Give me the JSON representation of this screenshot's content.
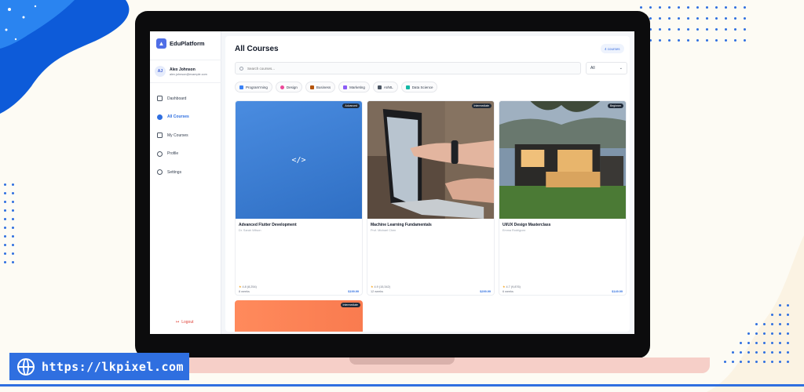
{
  "app": {
    "brand_name": "EduPlatform",
    "brand_icon": "graduation-cap-icon"
  },
  "user": {
    "initials": "AJ",
    "name": "Alex Johnson",
    "email": "alex.johnson@example.com"
  },
  "sidebar": {
    "items": [
      {
        "label": "Dashboard",
        "icon": "grid-icon",
        "active": false
      },
      {
        "label": "All Courses",
        "icon": "compass-icon",
        "active": true
      },
      {
        "label": "My Courses",
        "icon": "book-icon",
        "active": false
      },
      {
        "label": "Profile",
        "icon": "user-icon",
        "active": false
      },
      {
        "label": "Settings",
        "icon": "gear-icon",
        "active": false
      }
    ],
    "logout_label": "Logout"
  },
  "main": {
    "title": "All Courses",
    "count_badge": "4 courses",
    "search": {
      "placeholder": "Search courses..."
    },
    "filter": {
      "selected": "All"
    },
    "categories": [
      {
        "label": "Program'ming",
        "color": "#3b82f6"
      },
      {
        "label": "Design",
        "color": "#ec4899"
      },
      {
        "label": "Business",
        "color": "#b45309"
      },
      {
        "label": "Marketing",
        "color": "#8b5cf6"
      },
      {
        "label": "AI/ML",
        "color": "#4b5563"
      },
      {
        "label": "Data Science",
        "color": "#14b8a6"
      }
    ],
    "courses": [
      {
        "title": "Advanced Flutter Development",
        "author": "Dr. Sarah Wilson",
        "level": "Advanced",
        "rating": "4.8",
        "reviews": "(8,254)",
        "duration": "8 weeks",
        "price": "$199.99"
      },
      {
        "title": "Machine Learning Fundamentals",
        "author": "Prof. Michael Chen",
        "level": "Intermediate",
        "rating": "4.9",
        "reviews": "(15,342)",
        "duration": "12 weeks",
        "price": "$299.99"
      },
      {
        "title": "UI/UX Design Masterclass",
        "author": "Emma Rodriguez",
        "level": "Beginner",
        "rating": "4.7",
        "reviews": "(9,876)",
        "duration": "6 weeks",
        "price": "$149.99"
      },
      {
        "title": "",
        "author": "",
        "level": "Intermediate"
      }
    ]
  },
  "badge": {
    "url": "https://lkpixel.com"
  },
  "colors": {
    "accent": "#2f6fe0",
    "brand": "#4f6ee6",
    "logout": "#e0453b",
    "card_blue": "#3b7fd6",
    "card_orange": "#ff8a5c"
  }
}
